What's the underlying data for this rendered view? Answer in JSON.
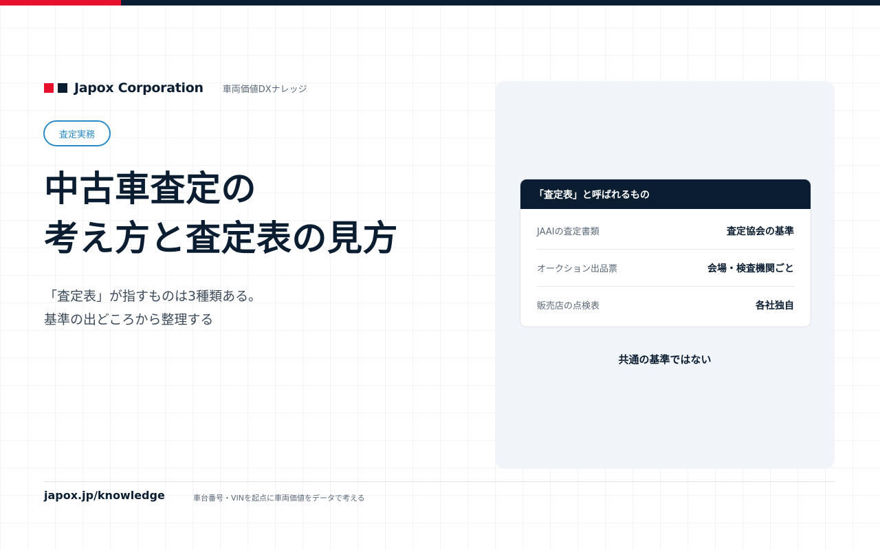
{
  "brand": {
    "name": "Japox Corporation",
    "subtitle": "車両価値DXナレッジ",
    "colors": {
      "accent": "#e8112d",
      "navy": "#0b1d30",
      "tag": "#2a8bc3"
    }
  },
  "tag": {
    "label": "査定実務"
  },
  "headline": {
    "line1": "中古車査定の",
    "line2": "考え方と査定表の見方"
  },
  "lead": {
    "line1": "「査定表」が指すものは3種類ある。",
    "line2": "基準の出どころから整理する"
  },
  "panel": {
    "card_title": "「査定表」と呼ばれるもの",
    "rows": [
      {
        "label": "JAAIの査定書類",
        "value": "査定協会の基準"
      },
      {
        "label": "オークション出品票",
        "value": "会場・検査機関ごと"
      },
      {
        "label": "販売店の点検表",
        "value": "各社独自"
      }
    ],
    "note": "共通の基準ではない"
  },
  "footer": {
    "url": "japox.jp/knowledge",
    "tagline": "車台番号・VINを起点に車両価値をデータで考える"
  }
}
